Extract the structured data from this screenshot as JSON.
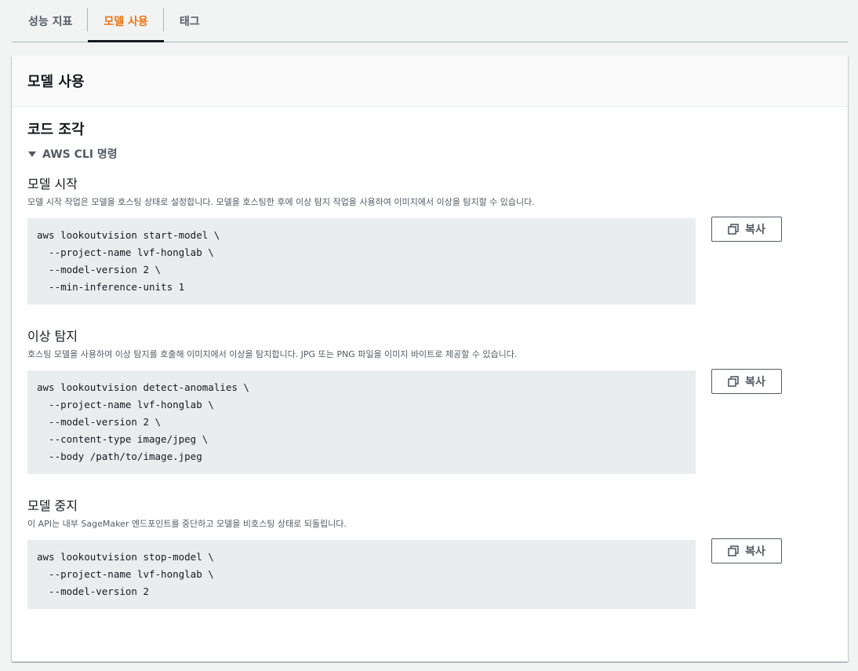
{
  "tabs": [
    {
      "label": "성능 지표",
      "active": false
    },
    {
      "label": "모델 사용",
      "active": true
    },
    {
      "label": "태그",
      "active": false
    }
  ],
  "panel": {
    "title": "모델 사용",
    "section_title": "코드 조각",
    "expander_label": "AWS CLI 명령",
    "blocks": [
      {
        "title": "모델 시작",
        "description": "모델 시작 작업은 모델을 호스팅 상태로 설정합니다. 모델을 호스팅한 후에 이상 탐지 작업을 사용하여 이미지에서 이상을 탐지할 수 있습니다.",
        "code": "aws lookoutvision start-model \\\n  --project-name lvf-honglab \\\n  --model-version 2 \\\n  --min-inference-units 1",
        "copy_label": "복사"
      },
      {
        "title": "이상 탐지",
        "description": "호스팅 모델을 사용하여 이상 탐지를 호출해 이미지에서 이상을 탐지합니다. JPG 또는 PNG 파일을 이미지 바이트로 제공할 수 있습니다.",
        "code": "aws lookoutvision detect-anomalies \\\n  --project-name lvf-honglab \\\n  --model-version 2 \\\n  --content-type image/jpeg \\\n  --body /path/to/image.jpeg",
        "copy_label": "복사"
      },
      {
        "title": "모델 중지",
        "description": "이 API는 내부 SageMaker 엔드포인트를 중단하고 모델을 비호스팅 상태로 되돌립니다.",
        "code": "aws lookoutvision stop-model \\\n  --project-name lvf-honglab \\\n  --model-version 2",
        "copy_label": "복사"
      }
    ]
  },
  "colors": {
    "active_tab": "#ec7211",
    "code_bg": "#eaeded",
    "text": "#16191f",
    "muted": "#545b64"
  },
  "icons": {
    "copy": "copy-icon",
    "expander": "caret-down-icon"
  }
}
